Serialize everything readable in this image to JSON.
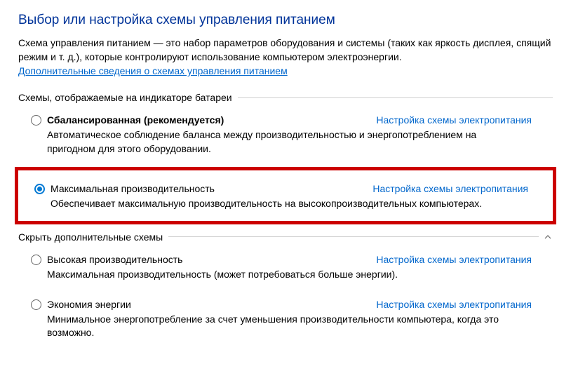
{
  "title": "Выбор или настройка схемы управления питанием",
  "description": "Схема управления питанием — это набор параметров оборудования и системы (таких как яркость дисплея, спящий режим и т. д.), которые контролируют использование компьютером электроэнергии.",
  "more_info_link": "Дополнительные сведения о схемах управления питанием",
  "section1": {
    "label": "Схемы, отображаемые на индикаторе батареи"
  },
  "section2": {
    "label": "Скрыть дополнительные схемы"
  },
  "settings_link": "Настройка схемы электропитания",
  "plans": {
    "balanced": {
      "name": "Сбалансированная (рекомендуется)",
      "desc": "Автоматическое соблюдение баланса между производительностью и энергопотреблением на пригодном для этого оборудовании."
    },
    "ultimate": {
      "name": "Максимальная производительность",
      "desc": "Обеспечивает максимальную производительность на высокопроизводительных компьютерах."
    },
    "high": {
      "name": "Высокая производительность",
      "desc": "Максимальная производительность (может потребоваться больше энергии)."
    },
    "saver": {
      "name": "Экономия энергии",
      "desc": "Минимальное энергопотребление за счет уменьшения производительности компьютера, когда это возможно."
    }
  }
}
